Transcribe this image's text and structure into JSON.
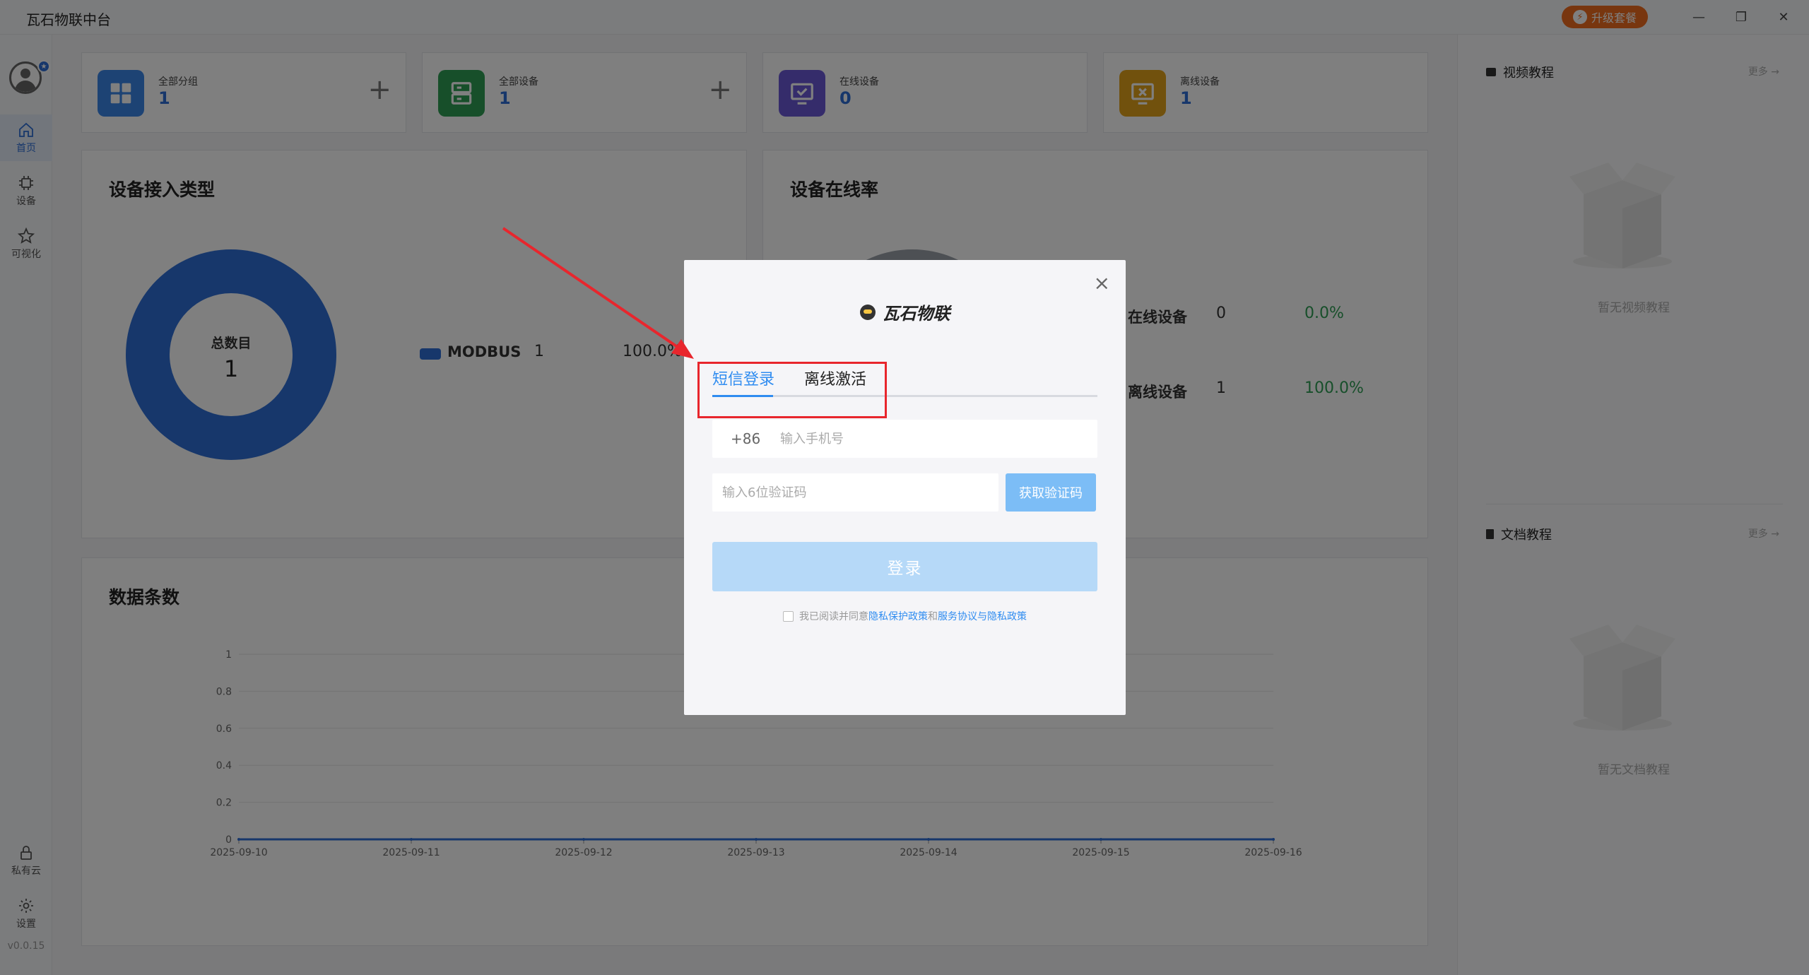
{
  "app": {
    "title": "瓦石物联中台",
    "upgrade_label": "升级套餐",
    "window": {
      "minimize": "—",
      "restore": "❐",
      "close": "✕"
    }
  },
  "sidebar": {
    "items": [
      {
        "label": "首页",
        "icon": "home-icon",
        "active": true
      },
      {
        "label": "设备",
        "icon": "chip-icon"
      },
      {
        "label": "可视化",
        "icon": "star-icon"
      },
      {
        "label": "私有云",
        "icon": "lock-icon"
      },
      {
        "label": "设置",
        "icon": "gear-icon"
      }
    ],
    "version": "v0.0.15"
  },
  "stats": [
    {
      "label": "全部分组",
      "value": "1",
      "color": "#3a86e8",
      "icon": "grid-icon",
      "plus": "+"
    },
    {
      "label": "全部设备",
      "value": "1",
      "color": "#2e9e55",
      "icon": "server-icon",
      "plus": "+"
    },
    {
      "label": "在线设备",
      "value": "0",
      "color": "#6b59d6",
      "icon": "monitor-check-icon"
    },
    {
      "label": "离线设备",
      "value": "1",
      "color": "#e3a21a",
      "icon": "monitor-x-icon"
    }
  ],
  "access_type": {
    "title": "设备接入类型",
    "center_label": "总数目",
    "center_value": "1",
    "legend": [
      {
        "name": "MODBUS",
        "count": "1",
        "percent": "100.0%"
      }
    ]
  },
  "online_rate": {
    "title": "设备在线率",
    "rows": [
      {
        "name": "在线设备",
        "count": "0",
        "percent": "0.0%"
      },
      {
        "name": "离线设备",
        "count": "1",
        "percent": "100.0%"
      }
    ]
  },
  "data_count": {
    "title": "数据条数"
  },
  "chart_data": {
    "type": "line",
    "title": "数据条数",
    "x": [
      "2025-09-10",
      "2025-09-11",
      "2025-09-12",
      "2025-09-13",
      "2025-09-14",
      "2025-09-15",
      "2025-09-16"
    ],
    "series": [
      {
        "values": [
          0,
          0,
          0,
          0,
          0,
          0,
          0
        ]
      }
    ],
    "yticks": [
      "0",
      "0.2",
      "0.4",
      "0.6",
      "0.8",
      "1"
    ],
    "ylim": [
      0,
      1
    ],
    "grid": true,
    "color": "#2f6fd6"
  },
  "right_panel": {
    "video": {
      "title": "视频教程",
      "more": "更多 →",
      "empty": "暂无视频教程"
    },
    "docs": {
      "title": "文档教程",
      "more": "更多 →",
      "empty": "暂无文档教程"
    }
  },
  "login_modal": {
    "brand": "瓦石物联",
    "close": "×",
    "tabs": [
      {
        "label": "短信登录",
        "active": true
      },
      {
        "label": "离线激活"
      }
    ],
    "phone_prefix": "+86",
    "phone_placeholder": "输入手机号",
    "code_placeholder": "输入6位验证码",
    "get_code": "获取验证码",
    "login": "登录",
    "agree_prefix": "我已阅读并同意",
    "agree_link1": "隐私保护政策",
    "agree_mid": "和",
    "agree_link2": "服务协议与隐私政策"
  }
}
